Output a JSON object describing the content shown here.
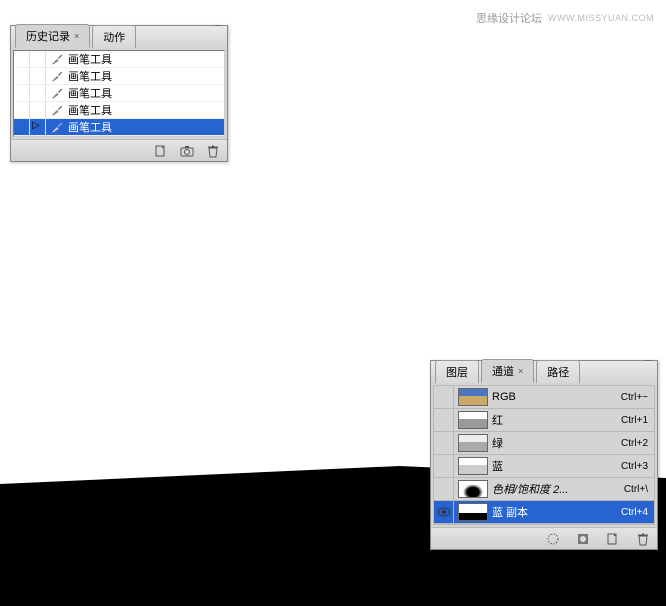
{
  "watermark": {
    "site": "思缘设计论坛",
    "url": "WWW.MISSYUAN.COM"
  },
  "history_panel": {
    "tabs": [
      {
        "label": "历史记录",
        "active": true
      },
      {
        "label": "动作",
        "active": false
      }
    ],
    "items": [
      {
        "label": "画笔工具",
        "selected": false
      },
      {
        "label": "画笔工具",
        "selected": false
      },
      {
        "label": "画笔工具",
        "selected": false
      },
      {
        "label": "画笔工具",
        "selected": false
      },
      {
        "label": "画笔工具",
        "selected": true
      }
    ]
  },
  "channels_panel": {
    "tabs": [
      {
        "label": "图层",
        "active": false
      },
      {
        "label": "通道",
        "active": true
      },
      {
        "label": "路径",
        "active": false
      }
    ],
    "channels": [
      {
        "name": "RGB",
        "shortcut": "Ctrl+~",
        "thumb": "rgb",
        "selected": false,
        "visible": false
      },
      {
        "name": "红",
        "shortcut": "Ctrl+1",
        "thumb": "red",
        "selected": false,
        "visible": false
      },
      {
        "name": "绿",
        "shortcut": "Ctrl+2",
        "thumb": "green",
        "selected": false,
        "visible": false
      },
      {
        "name": "蓝",
        "shortcut": "Ctrl+3",
        "thumb": "blue",
        "selected": false,
        "visible": false
      },
      {
        "name": "色相/饱和度 2...",
        "shortcut": "Ctrl+\\",
        "thumb": "mask",
        "selected": false,
        "visible": false
      },
      {
        "name": "蓝 副本",
        "shortcut": "Ctrl+4",
        "thumb": "copy",
        "selected": true,
        "visible": true
      }
    ]
  }
}
